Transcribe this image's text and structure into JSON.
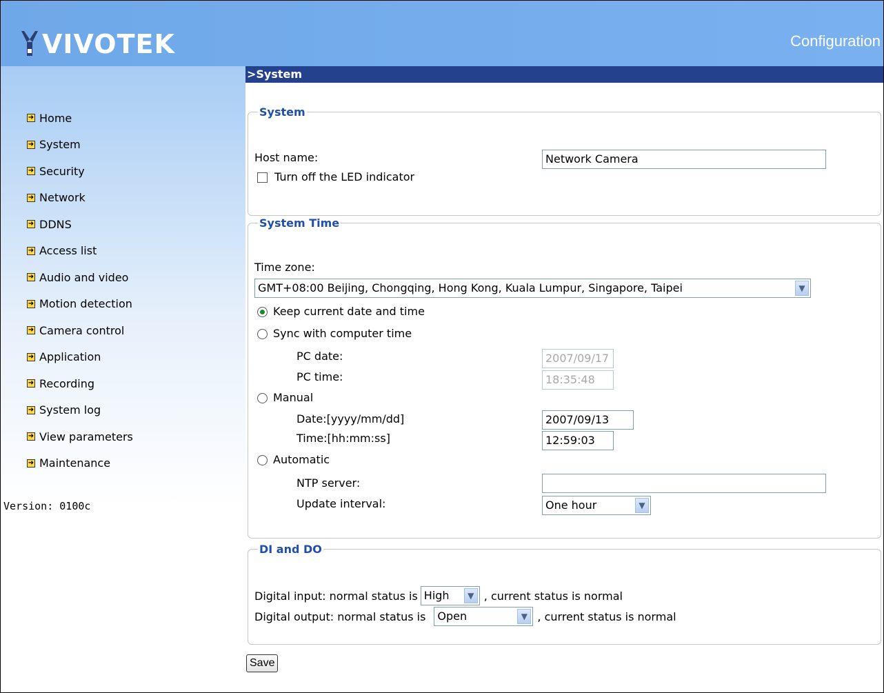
{
  "header": {
    "logo_text": "VIVOTEK",
    "config_title": "Configuration"
  },
  "sidebar": {
    "items": [
      {
        "label": "Home"
      },
      {
        "label": "System"
      },
      {
        "label": "Security"
      },
      {
        "label": "Network"
      },
      {
        "label": "DDNS"
      },
      {
        "label": "Access list"
      },
      {
        "label": "Audio and video"
      },
      {
        "label": "Motion detection"
      },
      {
        "label": "Camera control"
      },
      {
        "label": "Application"
      },
      {
        "label": "Recording"
      },
      {
        "label": "System log"
      },
      {
        "label": "View parameters"
      },
      {
        "label": "Maintenance"
      }
    ],
    "version": "Version: 0100c"
  },
  "page_title": ">System",
  "system": {
    "legend": "System",
    "host_label": "Host name:",
    "host_value": "Network Camera",
    "led_label": "Turn off the LED indicator",
    "led_checked": false
  },
  "system_time": {
    "legend": "System Time",
    "tz_label": "Time zone:",
    "tz_value": "GMT+08:00 Beijing, Chongqing, Hong Kong, Kuala Lumpur, Singapore, Taipei",
    "keep_label": "Keep current date and time",
    "sync_label": "Sync with computer time",
    "pc_date_label": "PC date:",
    "pc_date_value": "2007/09/17",
    "pc_time_label": "PC time:",
    "pc_time_value": "18:35:48",
    "manual_label": "Manual",
    "date_label": "Date:[yyyy/mm/dd]",
    "date_value": "2007/09/13",
    "time_label": "Time:[hh:mm:ss]",
    "time_value": "12:59:03",
    "auto_label": "Automatic",
    "ntp_label": "NTP server:",
    "ntp_value": "",
    "interval_label": "Update interval:",
    "interval_value": "One hour",
    "selected_mode": "keep"
  },
  "dio": {
    "legend": "DI and DO",
    "di_prefix": "Digital input: normal status is",
    "di_value": "High",
    "di_suffix": ", current status is normal",
    "do_prefix": "Digital output: normal status is",
    "do_value": "Open",
    "do_suffix": ", current status is normal"
  },
  "save_label": "Save"
}
